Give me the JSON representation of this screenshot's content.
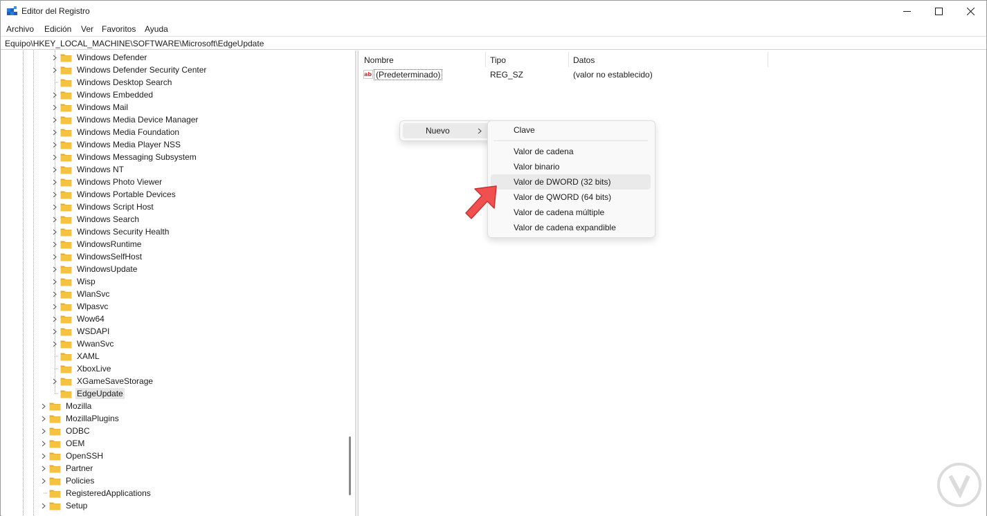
{
  "window": {
    "title": "Editor del Registro",
    "minimize_icon": "minimize-icon",
    "maximize_icon": "maximize-icon",
    "close_icon": "close-icon"
  },
  "menu": {
    "items": [
      "Archivo",
      "Edición",
      "Ver",
      "Favoritos",
      "Ayuda"
    ]
  },
  "address": {
    "path": "Equipo\\HKEY_LOCAL_MACHINE\\SOFTWARE\\Microsoft\\EdgeUpdate"
  },
  "tree": {
    "items": [
      {
        "label": "Windows Defender",
        "expandable": true
      },
      {
        "label": "Windows Defender Security Center",
        "expandable": true
      },
      {
        "label": "Windows Desktop Search",
        "expandable": false
      },
      {
        "label": "Windows Embedded",
        "expandable": true
      },
      {
        "label": "Windows Mail",
        "expandable": true
      },
      {
        "label": "Windows Media Device Manager",
        "expandable": true
      },
      {
        "label": "Windows Media Foundation",
        "expandable": true
      },
      {
        "label": "Windows Media Player NSS",
        "expandable": true
      },
      {
        "label": "Windows Messaging Subsystem",
        "expandable": true
      },
      {
        "label": "Windows NT",
        "expandable": true
      },
      {
        "label": "Windows Photo Viewer",
        "expandable": true
      },
      {
        "label": "Windows Portable Devices",
        "expandable": true
      },
      {
        "label": "Windows Script Host",
        "expandable": true
      },
      {
        "label": "Windows Search",
        "expandable": true
      },
      {
        "label": "Windows Security Health",
        "expandable": true
      },
      {
        "label": "WindowsRuntime",
        "expandable": true
      },
      {
        "label": "WindowsSelfHost",
        "expandable": true
      },
      {
        "label": "WindowsUpdate",
        "expandable": true
      },
      {
        "label": "Wisp",
        "expandable": true
      },
      {
        "label": "WlanSvc",
        "expandable": true
      },
      {
        "label": "Wlpasvc",
        "expandable": true
      },
      {
        "label": "Wow64",
        "expandable": true
      },
      {
        "label": "WSDAPI",
        "expandable": true
      },
      {
        "label": "WwanSvc",
        "expandable": true
      },
      {
        "label": "XAML",
        "expandable": false
      },
      {
        "label": "XboxLive",
        "expandable": false
      },
      {
        "label": "XGameSaveStorage",
        "expandable": true
      },
      {
        "label": "EdgeUpdate",
        "expandable": false,
        "selected": true
      },
      {
        "label": "Mozilla",
        "expandable": true
      },
      {
        "label": "MozillaPlugins",
        "expandable": true
      },
      {
        "label": "ODBC",
        "expandable": true
      },
      {
        "label": "OEM",
        "expandable": true
      },
      {
        "label": "OpenSSH",
        "expandable": true
      },
      {
        "label": "Partner",
        "expandable": true
      },
      {
        "label": "Policies",
        "expandable": true
      },
      {
        "label": "RegisteredApplications",
        "expandable": false
      },
      {
        "label": "Setup",
        "expandable": true
      }
    ]
  },
  "list": {
    "columns": [
      "Nombre",
      "Tipo",
      "Datos"
    ],
    "rows": [
      {
        "name": "(Predeterminado)",
        "type": "REG_SZ",
        "data": "(valor no establecido)",
        "icon": "string-value-icon"
      }
    ]
  },
  "context_menu": {
    "parent_item": "Nuevo",
    "submenu": [
      "Clave",
      "Valor de cadena",
      "Valor binario",
      "Valor de DWORD (32 bits)",
      "Valor de QWORD (64 bits)",
      "Valor de cadena múltiple",
      "Valor de cadena expandible"
    ],
    "highlighted": "Valor de DWORD (32 bits)"
  },
  "colors": {
    "folder": "#f5c342",
    "folder_dark": "#e8a92a",
    "arrow": "#f0504f",
    "selection": "#e6e6e6"
  }
}
